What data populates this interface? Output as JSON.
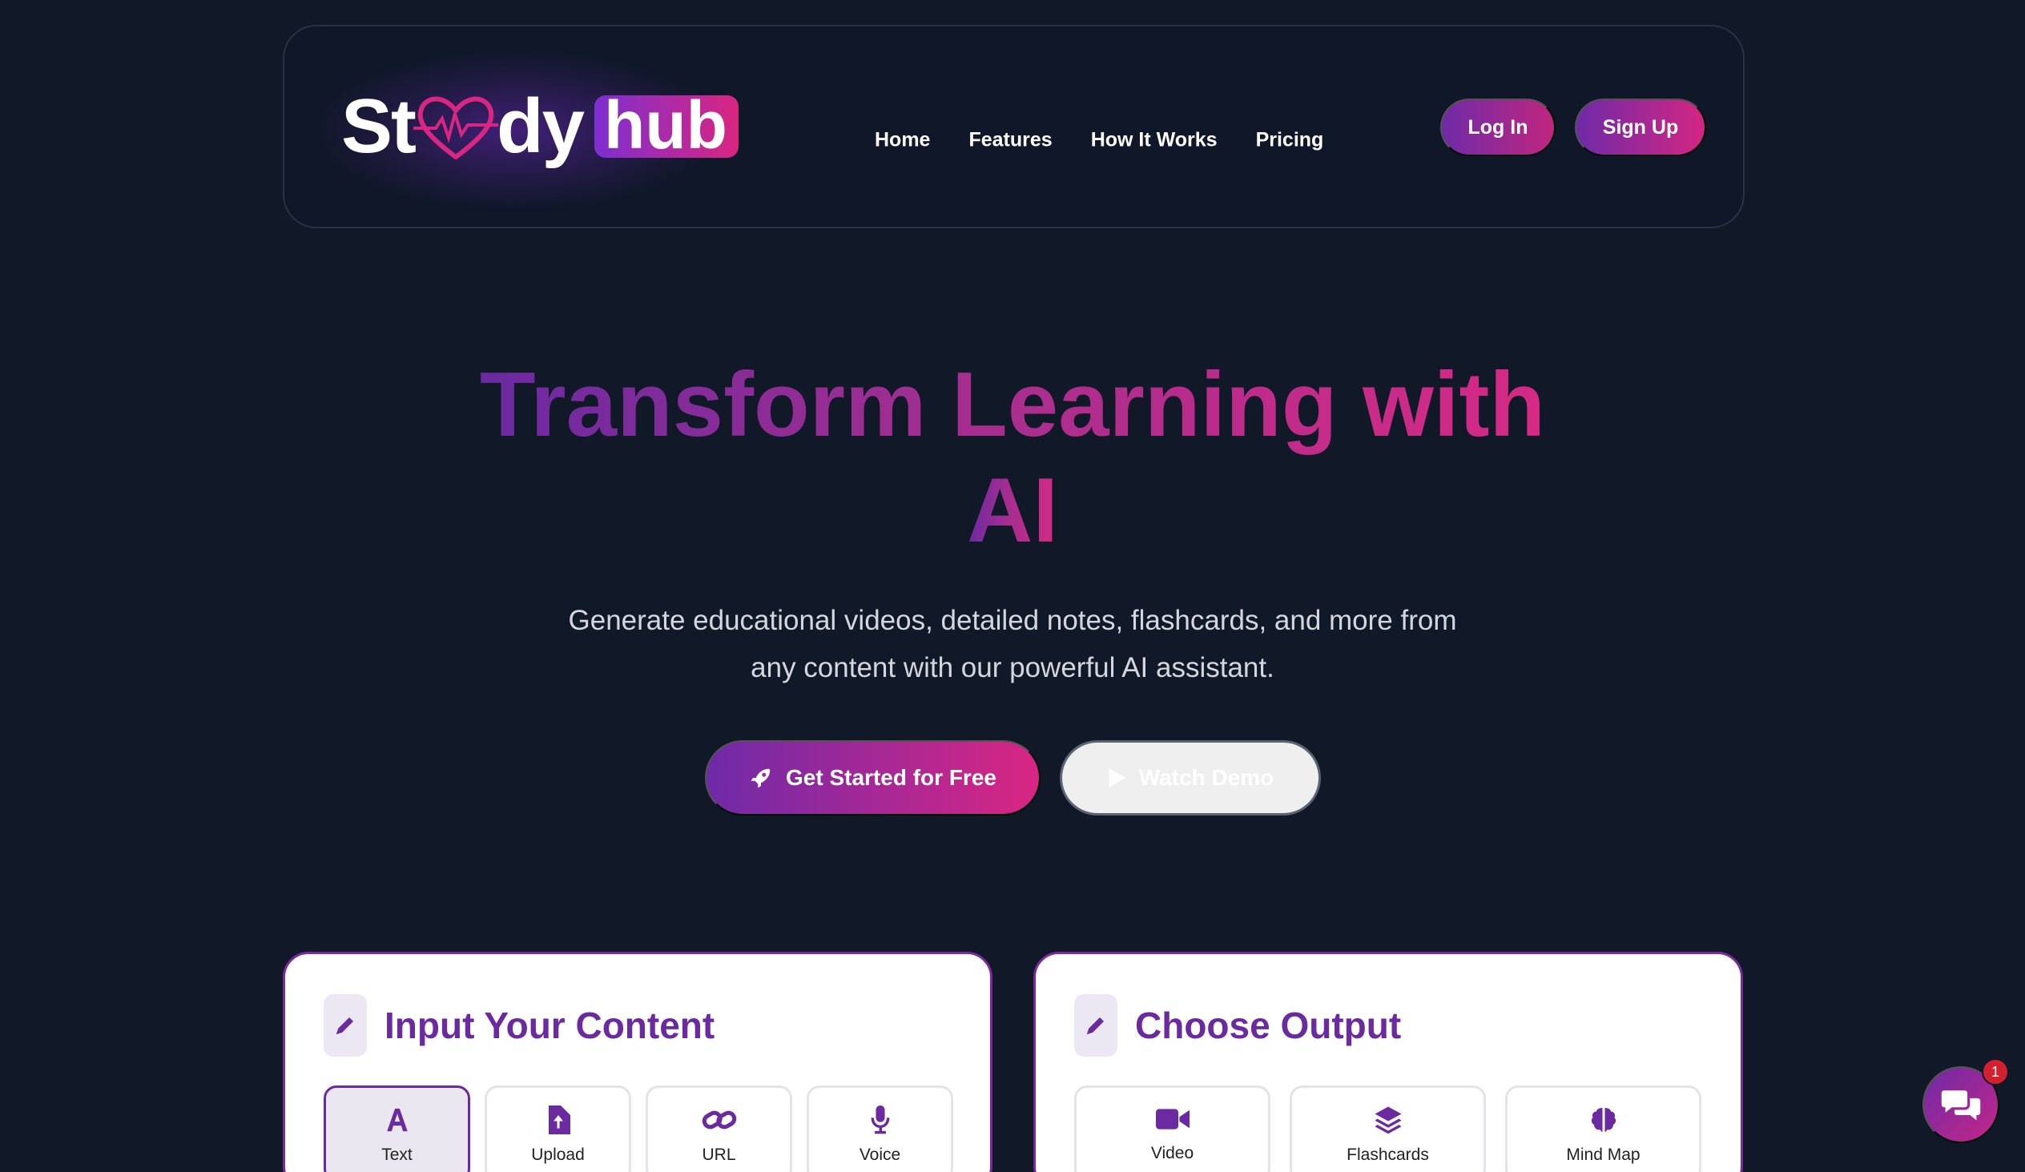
{
  "brand": {
    "logo_left": "St",
    "logo_mid": "dy",
    "logo_hub": "hub"
  },
  "nav": {
    "links": [
      "Home",
      "Features",
      "How It Works",
      "Pricing"
    ],
    "login_label": "Log In",
    "signup_label": "Sign Up"
  },
  "hero": {
    "title_line1": "Transform Learning with",
    "title_line2": "AI",
    "subtitle_line1": "Generate educational videos, detailed notes, flashcards, and more from",
    "subtitle_line2": "any content with our powerful AI assistant.",
    "primary_cta": "Get Started for Free",
    "secondary_cta": "Watch Demo"
  },
  "input_card": {
    "title": "Input Your Content",
    "options": [
      {
        "label": "Text",
        "icon": "font-icon",
        "selected": true
      },
      {
        "label": "Upload",
        "icon": "file-upload-icon",
        "selected": false
      },
      {
        "label": "URL",
        "icon": "link-icon",
        "selected": false
      },
      {
        "label": "Voice",
        "icon": "microphone-icon",
        "selected": false
      }
    ]
  },
  "output_card": {
    "title": "Choose Output",
    "options": [
      {
        "label": "Video",
        "icon": "video-icon"
      },
      {
        "label": "Flashcards",
        "icon": "layers-icon"
      },
      {
        "label": "Mind Map",
        "icon": "brain-icon"
      }
    ]
  },
  "chat": {
    "badge_count": "1"
  },
  "colors": {
    "background": "#111828",
    "accent_purple": "#6b2aa0",
    "accent_pink": "#d92683"
  }
}
